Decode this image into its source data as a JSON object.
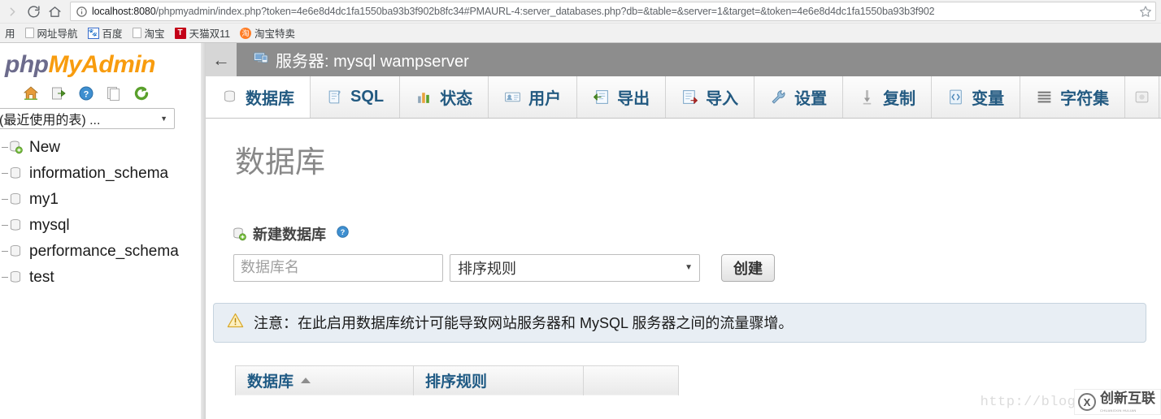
{
  "browser": {
    "back_icon": "back-arrow-icon",
    "reload_icon": "reload-icon",
    "home_icon": "home-icon",
    "info_icon": "info-circle-icon",
    "star_icon": "star-icon",
    "url_host": "localhost:8080",
    "url_rest": "/phpmyadmin/index.php?token=4e6e8d4dc1fa1550ba93b3f902b8fc34#PMAURL-4:server_databases.php?db=&table=&server=1&target=&token=4e6e8d4dc1fa1550ba93b3f902",
    "bookmarks": [
      {
        "label": "用",
        "icon": "partial-bookmark-icon"
      },
      {
        "label": "网址导航",
        "icon": "page-icon"
      },
      {
        "label": "百度",
        "icon": "baidu-icon"
      },
      {
        "label": "淘宝",
        "icon": "page-icon"
      },
      {
        "label": "天猫双11",
        "icon": "tmall-icon"
      },
      {
        "label": "淘宝特卖",
        "icon": "taobao-icon"
      }
    ]
  },
  "sidebar": {
    "logo_php": "php",
    "logo_myadmin": "MyAdmin",
    "icons": [
      {
        "name": "home-icon"
      },
      {
        "name": "logout-icon"
      },
      {
        "name": "help-icon"
      },
      {
        "name": "docs-icon"
      },
      {
        "name": "reload-icon"
      }
    ],
    "recent_tables_label": "(最近使用的表) ...",
    "recent_tables_caret": "▼",
    "databases": [
      {
        "label": "New",
        "icon": "new-database-icon"
      },
      {
        "label": "information_schema",
        "icon": "database-icon"
      },
      {
        "label": "my1",
        "icon": "database-icon"
      },
      {
        "label": "mysql",
        "icon": "database-icon"
      },
      {
        "label": "performance_schema",
        "icon": "database-icon"
      },
      {
        "label": "test",
        "icon": "database-icon"
      }
    ]
  },
  "header": {
    "back_label": "←",
    "server_title": "服务器: mysql wampserver",
    "server_icon": "server-icon"
  },
  "tabs": [
    {
      "label": "数据库",
      "icon": "database-icon",
      "active": true
    },
    {
      "label": "SQL",
      "icon": "sql-icon",
      "active": false
    },
    {
      "label": "状态",
      "icon": "status-chart-icon",
      "active": false
    },
    {
      "label": "用户",
      "icon": "users-icon",
      "active": false
    },
    {
      "label": "导出",
      "icon": "export-icon",
      "active": false
    },
    {
      "label": "导入",
      "icon": "import-icon",
      "active": false
    },
    {
      "label": "设置",
      "icon": "wrench-icon",
      "active": false
    },
    {
      "label": "复制",
      "icon": "replication-icon",
      "active": false
    },
    {
      "label": "变量",
      "icon": "variables-icon",
      "active": false
    },
    {
      "label": "字符集",
      "icon": "charset-icon",
      "active": false
    }
  ],
  "main": {
    "page_title": "数据库",
    "new_db_section_label": "新建数据库",
    "new_db_icon": "new-database-icon",
    "help_icon": "help-icon",
    "db_name_placeholder": "数据库名",
    "db_name_value": "",
    "collation_label": "排序规则",
    "collation_caret": "▼",
    "create_button_label": "创建",
    "notice_icon": "warning-triangle-icon",
    "notice_text": "注意：在此启用数据库统计可能导致网站服务器和 MySQL 服务器之间的流量骤增。",
    "table": {
      "columns": [
        "数据库",
        "排序规则",
        ""
      ],
      "sort_column": "数据库",
      "sort_direction": "asc",
      "rows": []
    }
  },
  "watermark": {
    "url": "http://blog.csdn.ne",
    "badge_mark": "X",
    "badge_text": "创新互联",
    "badge_sub": "CHUANGXIN HULIAN"
  },
  "colors": {
    "accent_blue": "#235a81",
    "logo_orange": "#f89c0e",
    "logo_purple": "#6c6b8c",
    "header_gray": "#8d8d8d",
    "notice_bg": "#e8eef4"
  }
}
